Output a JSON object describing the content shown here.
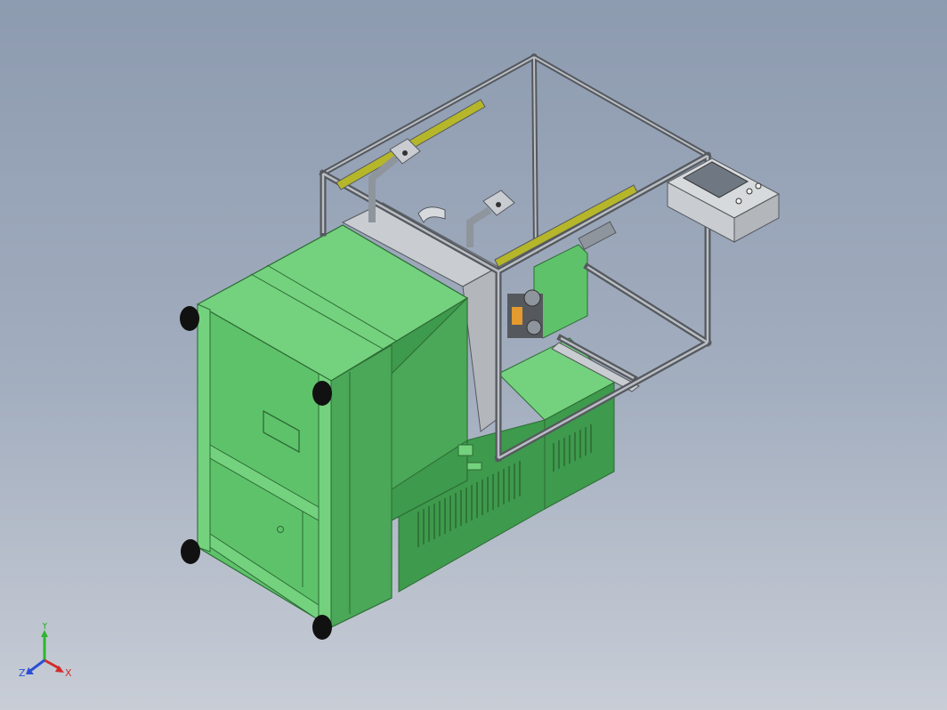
{
  "scene": {
    "background_top": "#8d9bb0",
    "background_bottom": "#c8cdd6"
  },
  "model": {
    "colors": {
      "green_main": "#5ec26a",
      "green_dark": "#3e9a4c",
      "green_light": "#74d27e",
      "frame_gray": "#8e959c",
      "frame_dark": "#55595e",
      "panel_gray": "#c9ccd0",
      "yellow_rail": "#b5b62a"
    }
  },
  "triad": {
    "y_label": "Y",
    "x_label": "X",
    "z_label": "Z",
    "y_color": "#2fb52f",
    "x_color": "#d42a2a",
    "z_color": "#2a4fd4"
  }
}
